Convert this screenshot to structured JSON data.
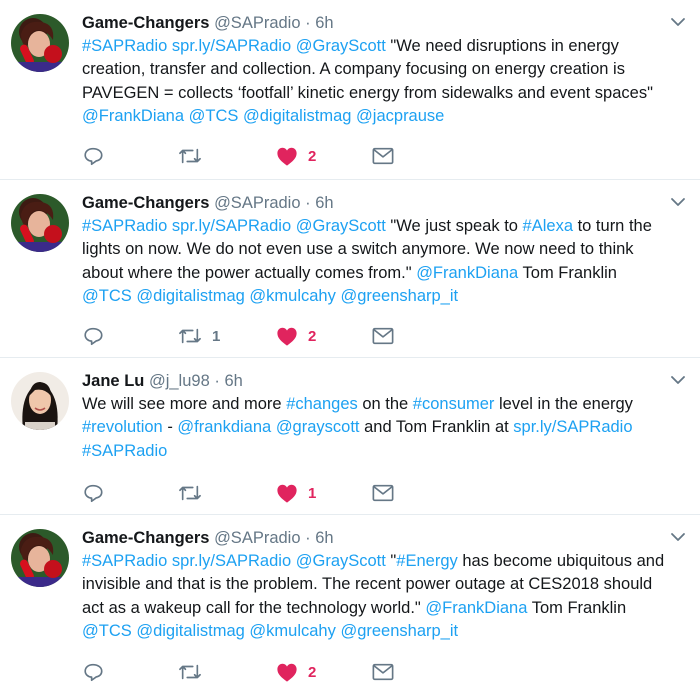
{
  "colors": {
    "accent": "#1da1f2",
    "like": "#e0245e",
    "muted": "#657786",
    "divider": "#e6ecf0"
  },
  "tweets": [
    {
      "name": "Game-Changers",
      "handle": "@SAPradio",
      "dot": "·",
      "time": "6h",
      "avatar_icon": "woman-red-phone-avatar",
      "body": [
        {
          "t": "#SAPRadio",
          "link": true
        },
        {
          "t": " "
        },
        {
          "t": "spr.ly/SAPRadio",
          "link": true
        },
        {
          "t": " "
        },
        {
          "t": "@GrayScott",
          "link": true
        },
        {
          "t": " \"We need disruptions in energy creation, transfer and collection. A company focusing on energy creation is PAVEGEN = collects ‘footfall’ kinetic energy from sidewalks and event spaces\" "
        },
        {
          "t": "@FrankDiana",
          "link": true
        },
        {
          "t": " "
        },
        {
          "t": "@TCS",
          "link": true
        },
        {
          "t": " "
        },
        {
          "t": "@digitalistmag",
          "link": true
        },
        {
          "t": " "
        },
        {
          "t": "@jacprause",
          "link": true
        }
      ],
      "retweets": "",
      "likes": "2"
    },
    {
      "name": "Game-Changers",
      "handle": "@SAPradio",
      "dot": "·",
      "time": "6h",
      "avatar_icon": "woman-red-phone-avatar",
      "body": [
        {
          "t": "#SAPRadio",
          "link": true
        },
        {
          "t": " "
        },
        {
          "t": "spr.ly/SAPRadio",
          "link": true
        },
        {
          "t": " "
        },
        {
          "t": "@GrayScott",
          "link": true
        },
        {
          "t": " \"We just speak to "
        },
        {
          "t": "#Alexa",
          "link": true
        },
        {
          "t": " to turn the lights on now. We do not even use a switch anymore. We now need to think about where the power actually comes from.\" "
        },
        {
          "t": "@FrankDiana",
          "link": true
        },
        {
          "t": " Tom Franklin "
        },
        {
          "t": "@TCS",
          "link": true
        },
        {
          "t": " "
        },
        {
          "t": "@digitalistmag",
          "link": true
        },
        {
          "t": " "
        },
        {
          "t": "@kmulcahy",
          "link": true
        },
        {
          "t": " "
        },
        {
          "t": "@greensharp_it",
          "link": true
        }
      ],
      "retweets": "1",
      "likes": "2"
    },
    {
      "name": "Jane Lu",
      "handle": "@j_lu98",
      "dot": "·",
      "time": "6h",
      "avatar_icon": "woman-portrait-avatar",
      "body": [
        {
          "t": "We will see more and more "
        },
        {
          "t": "#changes",
          "link": true
        },
        {
          "t": " on the "
        },
        {
          "t": "#consumer",
          "link": true
        },
        {
          "t": " level in the energy "
        },
        {
          "t": "#revolution",
          "link": true
        },
        {
          "t": " - "
        },
        {
          "t": "@frankdiana",
          "link": true
        },
        {
          "t": " "
        },
        {
          "t": "@grayscott",
          "link": true
        },
        {
          "t": " and Tom Franklin at "
        },
        {
          "t": "spr.ly/SAPRadio",
          "link": true
        },
        {
          "t": " "
        },
        {
          "t": "#SAPRadio",
          "link": true
        }
      ],
      "retweets": "",
      "likes": "1"
    },
    {
      "name": "Game-Changers",
      "handle": "@SAPradio",
      "dot": "·",
      "time": "6h",
      "avatar_icon": "woman-red-phone-avatar",
      "body": [
        {
          "t": "#SAPRadio",
          "link": true
        },
        {
          "t": " "
        },
        {
          "t": "spr.ly/SAPRadio",
          "link": true
        },
        {
          "t": " "
        },
        {
          "t": "@GrayScott",
          "link": true
        },
        {
          "t": "  \""
        },
        {
          "t": "#Energy",
          "link": true
        },
        {
          "t": " has become ubiquitous and invisible and that is the problem. The recent power outage at CES2018 should act as a wakeup call for the technology world.\" "
        },
        {
          "t": "@FrankDiana",
          "link": true
        },
        {
          "t": " Tom Franklin "
        },
        {
          "t": "@TCS",
          "link": true
        },
        {
          "t": " "
        },
        {
          "t": "@digitalistmag",
          "link": true
        },
        {
          "t": " "
        },
        {
          "t": "@kmulcahy",
          "link": true
        },
        {
          "t": " "
        },
        {
          "t": "@greensharp_it",
          "link": true
        }
      ],
      "retweets": "",
      "likes": "2"
    }
  ]
}
